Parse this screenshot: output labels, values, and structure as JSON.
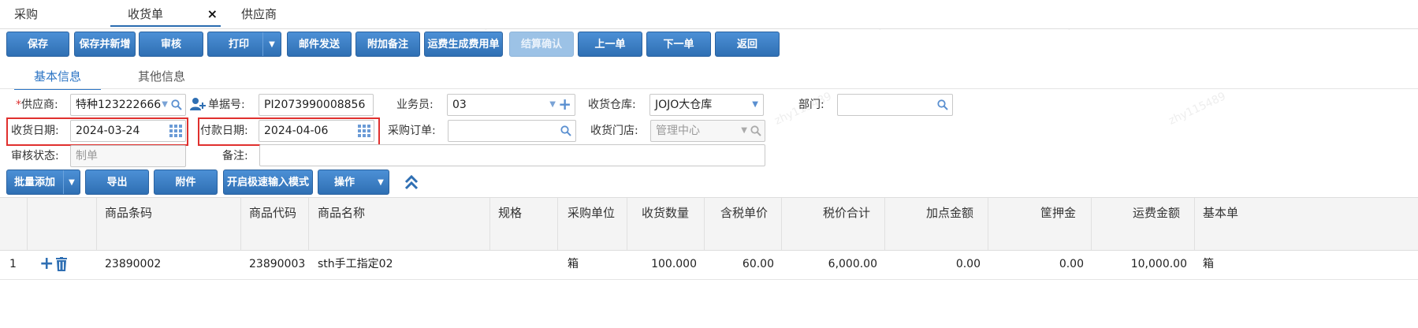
{
  "top_tabs": [
    {
      "label": "采购"
    },
    {
      "label": "收货单",
      "active": true
    },
    {
      "label": "供应商"
    }
  ],
  "toolbar": {
    "save": "保存",
    "save_new": "保存并新增",
    "audit": "审核",
    "print": "打印",
    "email": "邮件发送",
    "add_note": "附加备注",
    "freight_fee": "运费生成费用单",
    "settle_confirm": "结算确认",
    "prev": "上一单",
    "next": "下一单",
    "back": "返回"
  },
  "sub_tabs": {
    "basic": "基本信息",
    "other": "其他信息"
  },
  "form": {
    "supplier_label": "供应商:",
    "supplier_value": "特种123222666",
    "doc_no_label": "单据号:",
    "doc_no_value": "PI2073990008856",
    "salesman_label": "业务员:",
    "salesman_value": "03",
    "warehouse_label": "收货仓库:",
    "warehouse_value": "JOJO大仓库",
    "dept_label": "部门:",
    "dept_value": "",
    "receive_date_label": "收货日期:",
    "receive_date_value": "2024-03-24",
    "pay_date_label": "付款日期:",
    "pay_date_value": "2024-04-06",
    "po_label": "采购订单:",
    "po_value": "",
    "store_label": "收货门店:",
    "store_placeholder": "管理中心",
    "audit_status_label": "审核状态:",
    "audit_status_placeholder": "制单",
    "remark_label": "备注:",
    "remark_value": ""
  },
  "grid_toolbar": {
    "batch_add": "批量添加",
    "export": "导出",
    "attachment": "附件",
    "quick_input": "开启极速输入模式",
    "operation": "操作"
  },
  "table": {
    "headers": [
      "商品条码",
      "商品代码",
      "商品名称",
      "规格",
      "采购单位",
      "收货数量",
      "含税单价",
      "税价合计",
      "加点金额",
      "筐押金",
      "运费金额",
      "基本单"
    ],
    "rows": [
      {
        "index": "1",
        "barcode": "23890002",
        "code": "23890003",
        "name": "sth手工指定02",
        "spec": "",
        "unit": "箱",
        "qty": "100.000",
        "price": "60.00",
        "total": "6,000.00",
        "markup": "0.00",
        "deposit": "0.00",
        "freight": "10,000.00",
        "base_unit": "箱"
      }
    ]
  },
  "colors": {
    "accent": "#2f6fb3",
    "highlight_border": "#e0302e"
  }
}
